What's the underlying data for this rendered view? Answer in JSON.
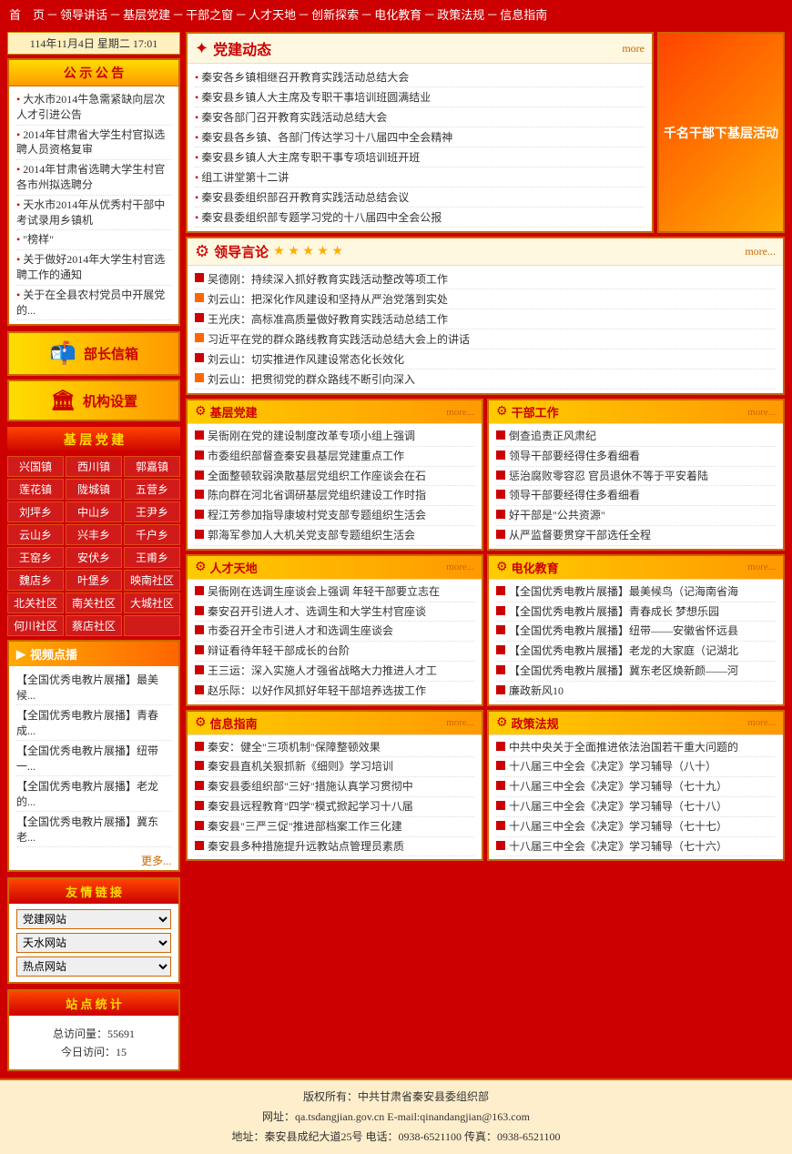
{
  "nav": {
    "items": [
      {
        "label": "首　页"
      },
      {
        "label": "－"
      },
      {
        "label": "领导讲话"
      },
      {
        "label": "－"
      },
      {
        "label": "基层党建"
      },
      {
        "label": "－"
      },
      {
        "label": "干部之窗"
      },
      {
        "label": "－"
      },
      {
        "label": "人才天地"
      },
      {
        "label": "－"
      },
      {
        "label": "创新探索"
      },
      {
        "label": "－"
      },
      {
        "label": "电化教育"
      },
      {
        "label": "－"
      },
      {
        "label": "政策法规"
      },
      {
        "label": "－"
      },
      {
        "label": "信息指南"
      }
    ]
  },
  "date_bar": "114年11月4日 星期二 17:01",
  "notice": {
    "title": "公 示 公 告",
    "items": [
      "大水市2014牛急需紧缺向层次人才引进公告",
      "2014年甘肃省大学生村官拟选聘人员资格复审",
      "2014年甘肃省选聘大学生村官各市州拟选聘分",
      "天水市2014年从优秀村干部中考试录用乡镇机",
      "\"榜样\"",
      "关于做好2014年大学生村官选聘工作的通知",
      "关于在全县农村党员中开展党的..."
    ]
  },
  "minister_mailbox": "部长信箱",
  "org_setup": "机构设置",
  "grassroots": {
    "title": "基 层 党 建",
    "towns": [
      "兴国镇",
      "西川镇",
      "郭嘉镇",
      "莲花镇",
      "陇城镇",
      "五营乡",
      "刘坪乡",
      "中山乡",
      "王尹乡",
      "云山乡",
      "兴丰乡",
      "千户乡",
      "王窑乡",
      "安伏乡",
      "王甫乡",
      "魏店乡",
      "叶堡乡",
      "映南社区",
      "北关社区",
      "南关社区",
      "大城社区",
      "何川社区",
      "蔡店社区",
      ""
    ]
  },
  "video": {
    "title": "视频点播",
    "items": [
      "【全国优秀电教片展播】最美候...",
      "【全国优秀电教片展播】青春成...",
      "【全国优秀电教片展播】纽带一...",
      "【全国优秀电教片展播】老龙的...",
      "【全国优秀电教片展播】冀东老..."
    ],
    "more": "更多..."
  },
  "friend_links": {
    "title": "友 情 链 接",
    "selects": [
      {
        "label": "党建网站",
        "options": [
          "党建网站"
        ]
      },
      {
        "label": "天水网站",
        "options": [
          "天水网站"
        ]
      },
      {
        "label": "热点网站",
        "options": [
          "热点网站"
        ]
      }
    ]
  },
  "site_stats": {
    "title": "站 点 统 计",
    "total_label": "总访问量：",
    "total_value": "55691",
    "today_label": "今日访问：",
    "today_value": "15"
  },
  "party_dynamics": {
    "title": "党建动态",
    "more": "more",
    "items": [
      "秦安各乡镇相继召开教育实践活动总结大会",
      "秦安县乡镇人大主席及专职干事培训班圆满结业",
      "秦安各部门召开教育实践活动总结大会",
      "秦安县各乡镇、各部门传达学习十八届四中全会精神",
      "秦安县乡镇人大主席专职干事专项培训班开班",
      "组工讲堂第十二讲",
      "秦安县委组织部召开教育实践活动总结会议",
      "秦安县委组织部专题学习党的十八届四中全会公报"
    ]
  },
  "activity_banner": "千名干部下基层活动",
  "leader_speeches": {
    "title": "领导言论",
    "more": "more...",
    "items": [
      "吴德刚：持续深入抓好教育实践活动整改等项工作",
      "刘云山：把深化作风建设和坚持从严治党落到实处",
      "王光庆：高标准高质量做好教育实践活动总结工作",
      "习近平在党的群众路线教育实践活动总结大会上的讲话",
      "刘云山：切实推进作风建设常态化长效化",
      "刘云山：把贯彻党的群众路线不断引向深入"
    ]
  },
  "sections": {
    "grassroots_party": {
      "name": "基层党建",
      "more": "more...",
      "items": [
        "吴衙刚在党的建设制度改革专项小组上强调",
        "市委组织部督查秦安县基层党建重点工作",
        "全面整顿软弱涣散基层党组织工作座谈会在石",
        "陈向群在河北省调研基层党组织建设工作时指",
        "程江芳参加指导康坡村党支部专题组织生活会",
        "郭海军参加人大机关党支部专题组织生活会"
      ]
    },
    "cadre_work": {
      "name": "干部工作",
      "more": "more...",
      "items": [
        "倒查追责正风肃纪",
        "领导干部要经得住多看细看",
        "惩治腐败零容忍 官员退休不等于平安着陆",
        "领导干部要经得住多看细看",
        "好干部是\"公共资源\"",
        "从严监督要贯穿干部选任全程"
      ]
    },
    "talent": {
      "name": "人才天地",
      "more": "more...",
      "items": [
        "吴衙刚在选调生座谈会上强调 年轻干部要立志在",
        "秦安召开引进人才、选调生和大学生村官座谈",
        "市委召开全市引进人才和选调生座谈会",
        "辩证看待年轻干部成长的台阶",
        "王三运：深入实施人才强省战略大力推进人才工",
        "赵乐际：以好作风抓好年轻干部培养选拔工作"
      ]
    },
    "electro_edu": {
      "name": "电化教育",
      "more": "more...",
      "items": [
        "【全国优秀电教片展播】最美候鸟（记海南省海",
        "【全国优秀电教片展播】青春成长 梦想乐园",
        "【全国优秀电教片展播】纽带——安徽省怀远县",
        "【全国优秀电教片展播】老龙的大家庭（记湖北",
        "【全国优秀电教片展播】冀东老区焕新颜——河",
        "廉政新风10"
      ]
    },
    "info_guide": {
      "name": "信息指南",
      "more": "more...",
      "items": [
        "秦安：健全\"三项机制\"保障整顿效果",
        "秦安县直机关狠抓新《细则》学习培训",
        "秦安县委组织部\"三好\"措施认真学习贯彻中",
        "秦安县远程教育\"四学\"模式掀起学习十八届",
        "秦安县\"三严三促\"推进部档案工作三化建",
        "秦安县多种措施提升远教站点管理员素质"
      ]
    },
    "policy_law": {
      "name": "政策法规",
      "more": "more...",
      "items": [
        "中共中央关于全面推进依法治国若干重大问题的",
        "十八届三中全会《决定》学习辅导（八十）",
        "十八届三中全会《决定》学习辅导（七十九）",
        "十八届三中全会《决定》学习辅导（七十八）",
        "十八届三中全会《决定》学习辅导（七十七）",
        "十八届三中全会《决定》学习辅导（七十六）"
      ]
    }
  },
  "more_label": "More",
  "footer": {
    "copyright": "版权所有：中共甘肃省秦安县委组织部",
    "website": "网址：qa.tsdangjian.gov.cn  E-mail:qinandangjian@163.com",
    "address": "地址：秦安县成纪大道25号  电话：0938-6521100  传真：0938-6521100"
  }
}
